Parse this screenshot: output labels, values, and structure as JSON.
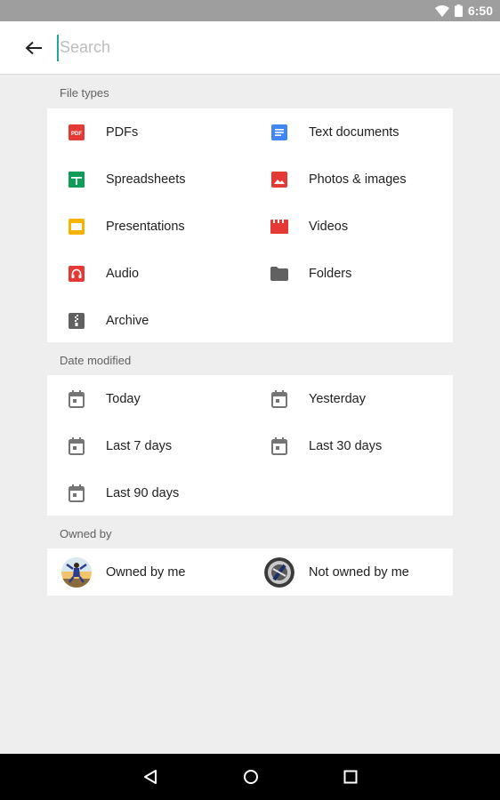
{
  "status_bar": {
    "time": "6:50"
  },
  "search": {
    "placeholder": "Search",
    "value": ""
  },
  "sections": {
    "file_types": {
      "label": "File types",
      "items": [
        {
          "label": "PDFs",
          "icon": "pdf-icon",
          "icon_text": "PDF",
          "color": "#e53935"
        },
        {
          "label": "Text documents",
          "icon": "text-document-icon",
          "color": "#4285f4"
        },
        {
          "label": "Spreadsheets",
          "icon": "spreadsheet-icon",
          "color": "#0f9d58"
        },
        {
          "label": "Photos & images",
          "icon": "image-icon",
          "color": "#e53935"
        },
        {
          "label": "Presentations",
          "icon": "presentation-icon",
          "color": "#f4b400"
        },
        {
          "label": "Videos",
          "icon": "video-icon",
          "color": "#e53935"
        },
        {
          "label": "Audio",
          "icon": "audio-icon",
          "color": "#e53935"
        },
        {
          "label": "Folders",
          "icon": "folder-icon",
          "color": "#616161"
        },
        {
          "label": "Archive",
          "icon": "archive-icon",
          "color": "#616161"
        }
      ]
    },
    "date_modified": {
      "label": "Date modified",
      "items": [
        {
          "label": "Today",
          "icon": "calendar-icon"
        },
        {
          "label": "Yesterday",
          "icon": "calendar-icon"
        },
        {
          "label": "Last 7 days",
          "icon": "calendar-icon"
        },
        {
          "label": "Last 30 days",
          "icon": "calendar-icon"
        },
        {
          "label": "Last 90 days",
          "icon": "calendar-icon"
        }
      ]
    },
    "owned_by": {
      "label": "Owned by",
      "items": [
        {
          "label": "Owned by me",
          "icon": "avatar-me"
        },
        {
          "label": "Not owned by me",
          "icon": "avatar-others"
        }
      ]
    }
  },
  "nav_bar": {
    "buttons": [
      "back-nav-icon",
      "home-nav-icon",
      "recents-nav-icon"
    ]
  }
}
